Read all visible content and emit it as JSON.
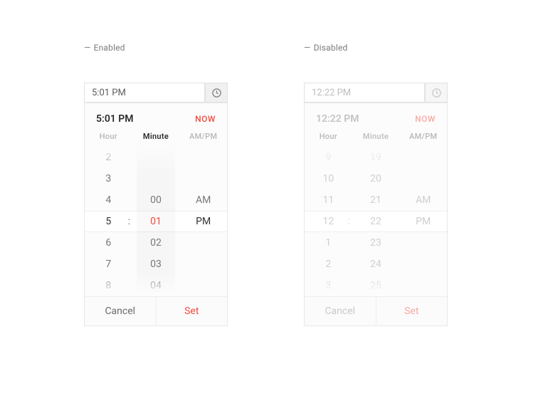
{
  "labels": {
    "enabled": "Enabled",
    "disabled": "Disabled"
  },
  "colors": {
    "accent": "#f54a3d"
  },
  "columns": {
    "hour": "Hour",
    "minute": "Minute",
    "ampm": "AM/PM"
  },
  "footer": {
    "cancel": "Cancel",
    "set": "Set"
  },
  "now_label": "NOW",
  "enabled": {
    "input_value": "5:01 PM",
    "header_time": "5:01 PM",
    "active_column": "minute",
    "hours": [
      "2",
      "3",
      "4",
      "5",
      "6",
      "7",
      "8"
    ],
    "minutes": [
      "",
      "",
      "00",
      "01",
      "02",
      "03",
      "04"
    ],
    "ampm": [
      "",
      "",
      "AM",
      "PM",
      "",
      "",
      ""
    ],
    "sel_index": 3,
    "accent_on": "minute"
  },
  "disabled": {
    "input_value": "12:22 PM",
    "header_time": "12:22 PM",
    "active_column": "minute",
    "hours": [
      "9",
      "10",
      "11",
      "12",
      "1",
      "2",
      "3"
    ],
    "minutes": [
      "19",
      "20",
      "21",
      "22",
      "23",
      "24",
      "25"
    ],
    "ampm": [
      "",
      "",
      "AM",
      "PM",
      "",
      "",
      ""
    ],
    "sel_index": 3,
    "accent_on": ""
  }
}
